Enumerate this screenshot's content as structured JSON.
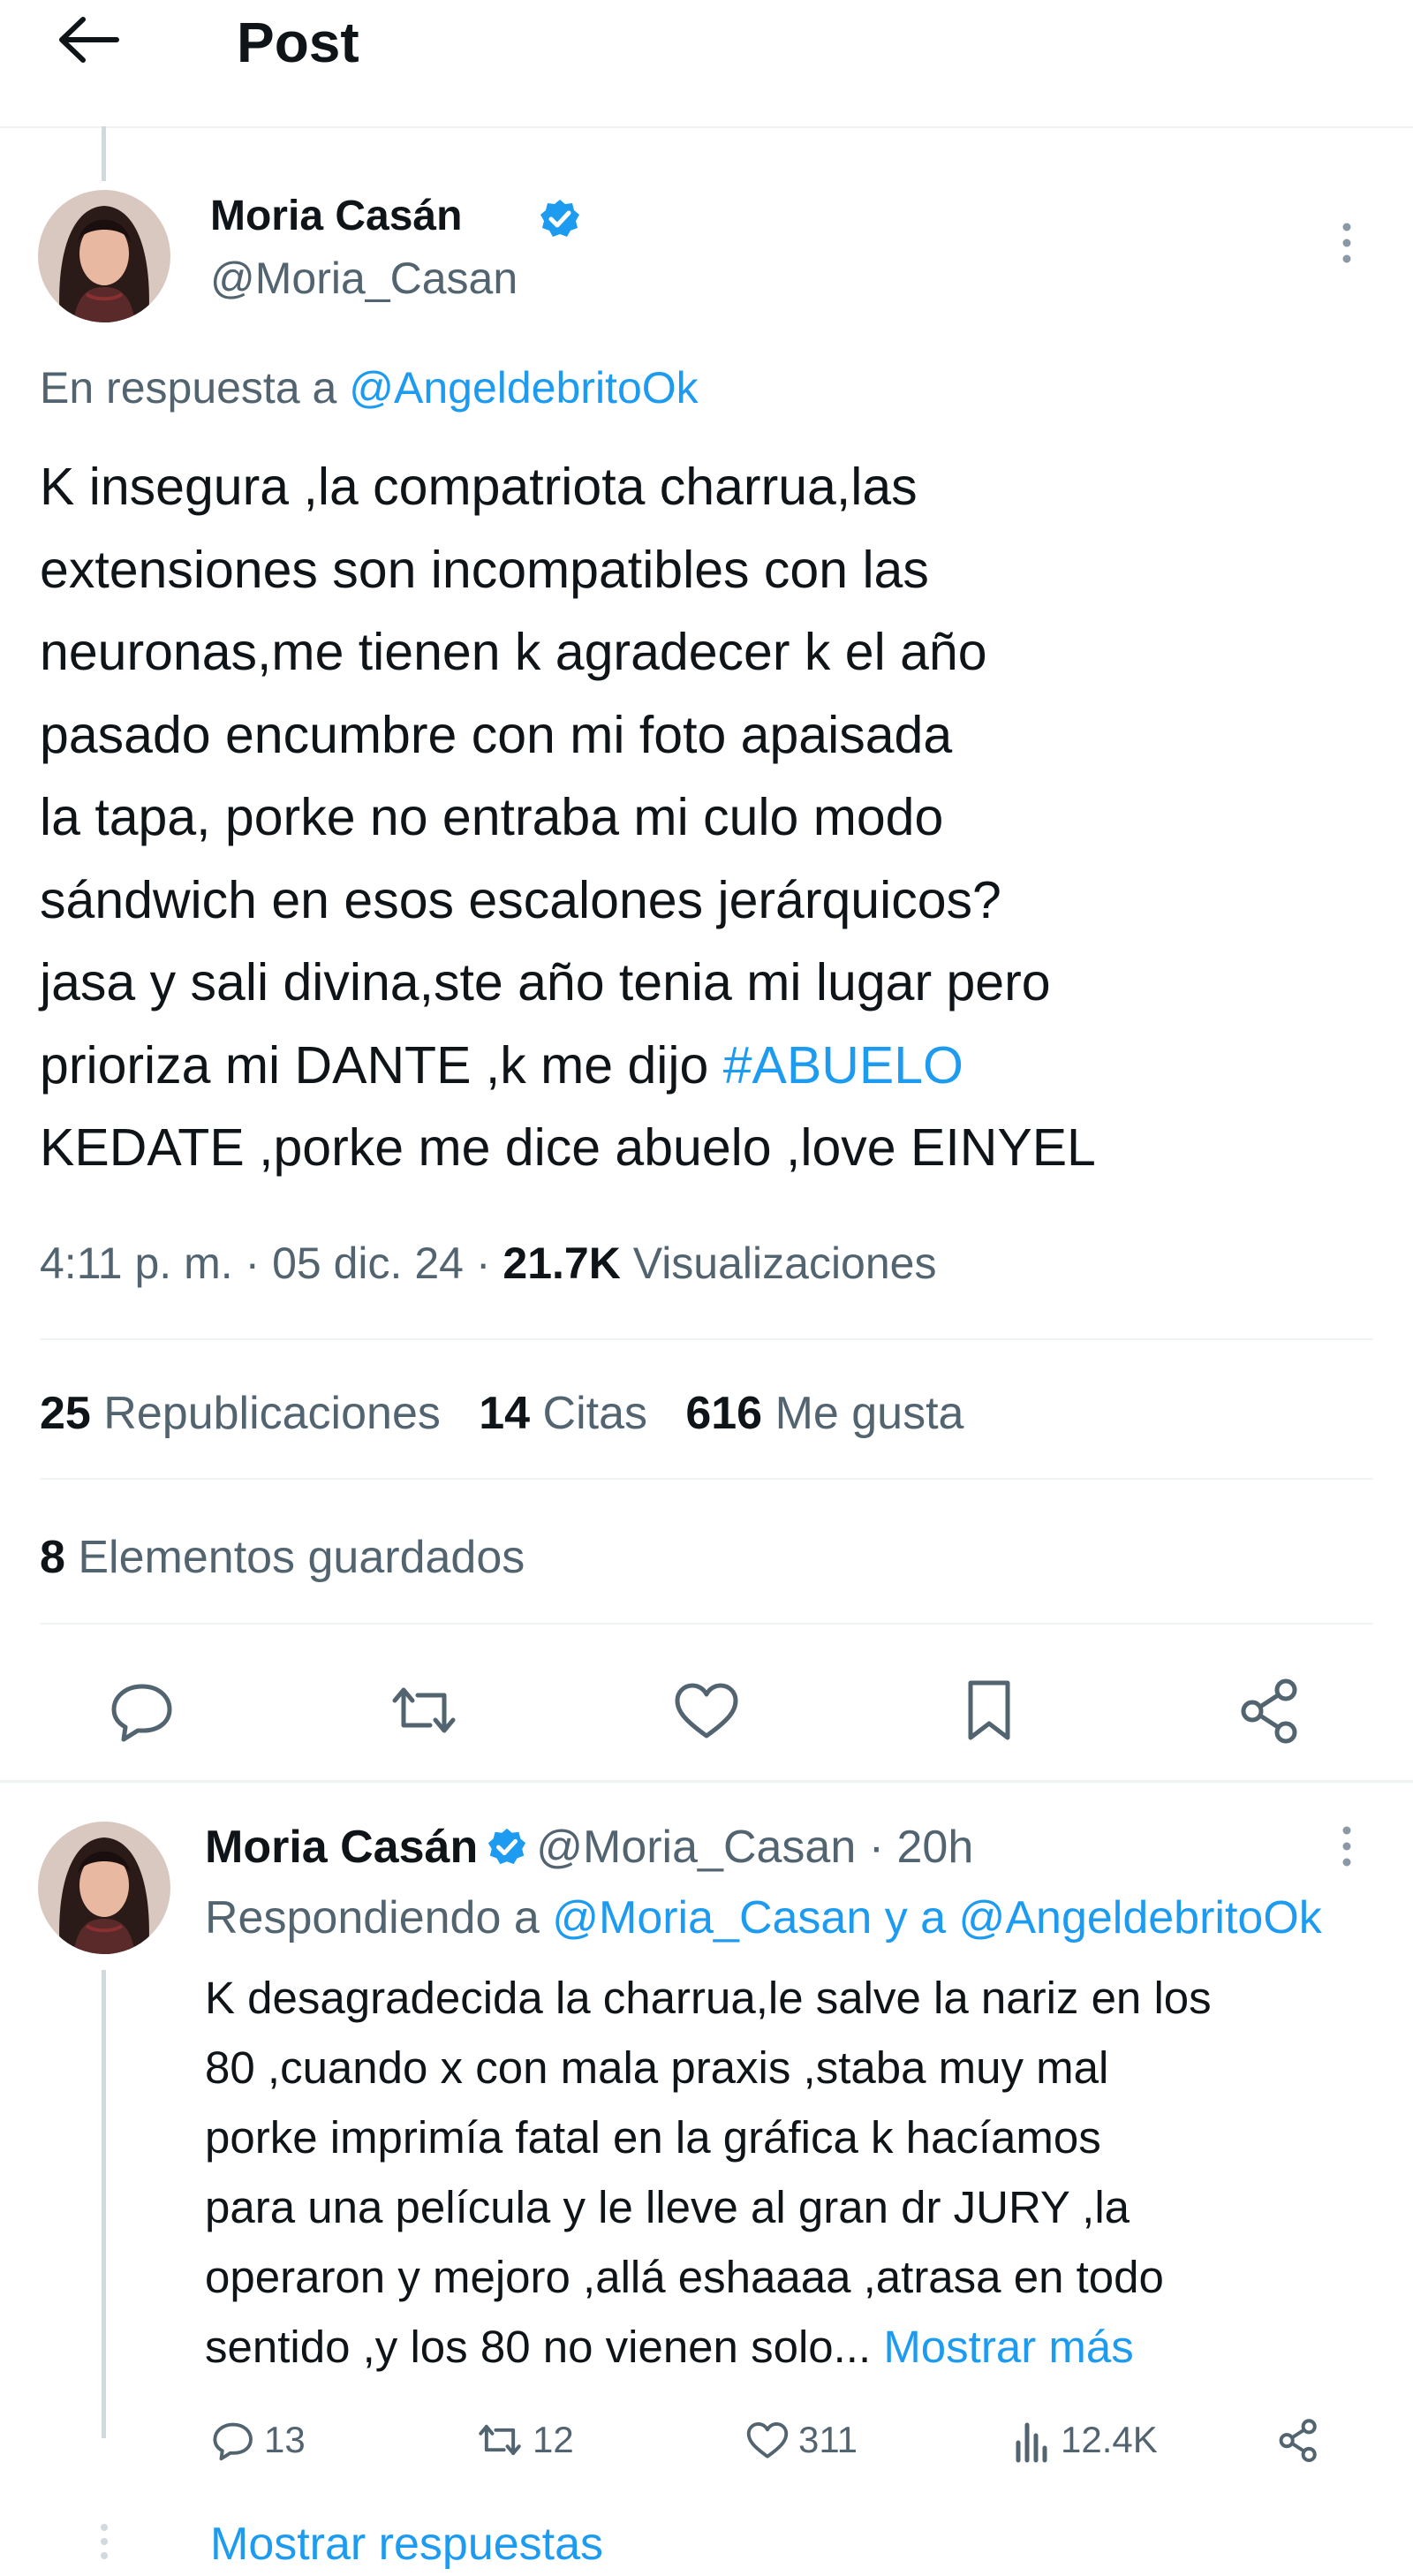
{
  "header": {
    "title": "Post"
  },
  "post": {
    "author_name": "Moria Casán",
    "author_handle": "@Moria_Casan",
    "reply_to_prefix": "En respuesta a",
    "reply_to_handle": "@AngeldebritoOk",
    "text_lines": [
      "K insegura ,la compatriota charrua,las",
      "extensiones son incompatibles con las",
      "neuronas,me tienen k agradecer k el año",
      "pasado encumbre con mi foto apaisada",
      "la tapa, porke no entraba mi culo modo",
      "sándwich en esos escalones jerárquicos?",
      "jasa y sali divina,ste año tenia mi lugar pero"
    ],
    "text_line8_before": "prioriza  mi DANTE ,k me dijo",
    "hashtag": "#ABUELO",
    "text_line9": "KEDATE ,porke me dice abuelo ,love EINYEL",
    "time": "4:11 p. m.",
    "date": "05 dic. 24",
    "views_count": "21.7K",
    "views_label": "Visualizaciones",
    "reposts_count": "25",
    "reposts_label": "Republicaciones",
    "quotes_count": "14",
    "quotes_label": "Citas",
    "likes_count": "616",
    "likes_label": "Me gusta",
    "bookmarks_count": "8",
    "bookmarks_label": "Elementos guardados"
  },
  "reply": {
    "author_name": "Moria Casán",
    "author_handle": "@Moria_Casan",
    "time_ago": "20h",
    "replying_prefix": "Respondiendo a",
    "replying_handle1": "@Moria_Casan",
    "replying_and": "y a",
    "replying_handle2": "@AngeldebritoOk",
    "text_lines": [
      "K desagradecida la charrua,le salve la nariz en los",
      "80 ,cuando x  con mala praxis ,staba muy mal",
      "porke imprimía fatal en la gráfica k hacíamos",
      "para una película y le lleve al gran dr JURY ,la",
      "operaron y mejoro ,allá eshaaaa ,atrasa en todo"
    ],
    "last_line": "sentido ,y los 80 no vienen solo...",
    "show_more": "Mostrar más",
    "replies": "13",
    "retweets": "12",
    "likes": "311",
    "views": "12.4K"
  },
  "show_replies": "Mostrar respuestas",
  "colors": {
    "accent": "#1d9bf0",
    "text": "#0f1419",
    "muted": "#536471"
  }
}
